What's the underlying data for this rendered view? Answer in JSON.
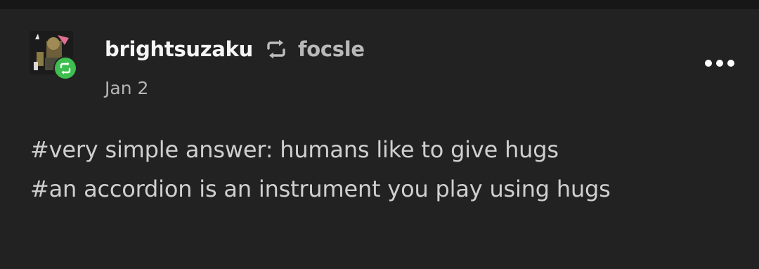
{
  "post": {
    "username": "brightsuzaku",
    "reblogged_from": "focsle",
    "date": "Jan 2",
    "tags": [
      "#very simple answer: humans like to give hugs",
      "#an accordion is an instrument you play using hugs"
    ]
  },
  "icons": {
    "reblog": "reblog-icon",
    "more": "more-dots-icon",
    "badge": "reblog-badge-icon"
  },
  "colors": {
    "background": "#222222",
    "badge_green": "#3fbf4f",
    "username": "#f5f5f5",
    "secondary_text": "#b5b5b5"
  }
}
